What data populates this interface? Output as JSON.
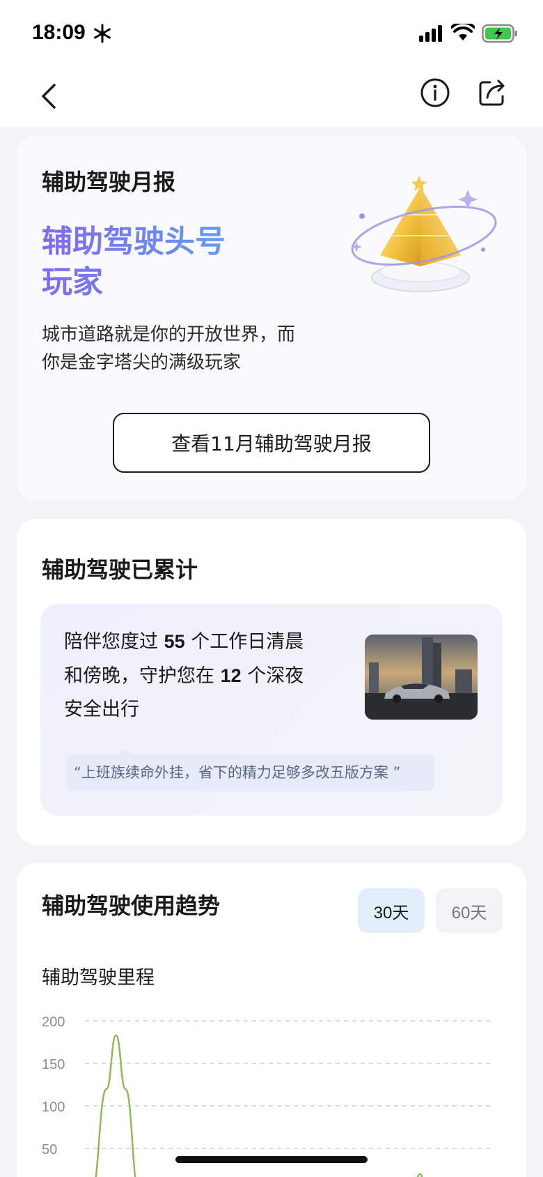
{
  "status_bar": {
    "time": "18:09"
  },
  "nav": {
    "back_icon": "chevron-left-icon",
    "info_icon": "info-icon",
    "share_icon": "share-icon"
  },
  "report_card": {
    "title": "辅助驾驶月报",
    "headline_line1": "辅助驾驶头号",
    "headline_line2": "玩家",
    "description_line1": "城市道路就是你的开放世界，而",
    "description_line2": "你是金字塔尖的满级玩家",
    "button_label": "查看11月辅助驾驶月报"
  },
  "total_card": {
    "title": "辅助驾驶已累计",
    "line1_prefix": "陪伴您度过 ",
    "workdays": "55",
    "line1_suffix": " 个工作日清晨",
    "line2_prefix": "和傍晚，守护您在 ",
    "nights": "12",
    "line2_suffix": " 个深夜",
    "line3": "安全出行",
    "quote": "“上班族续命外挂，省下的精力足够多改五版方案 ”"
  },
  "trend_card": {
    "title": "辅助驾驶使用趋势",
    "tabs": [
      {
        "label": "30天",
        "selected": true
      },
      {
        "label": "60天",
        "selected": false
      }
    ],
    "chart_subtitle": "辅助驾驶里程"
  },
  "chart_data": {
    "type": "line",
    "title": "",
    "ylabel": "",
    "xlabel": "",
    "ylim": [
      0,
      200
    ],
    "y_ticks": [
      "200",
      "150",
      "100",
      "50"
    ],
    "grid": true,
    "series": [
      {
        "color": "#8fba5a",
        "points": [
          {
            "x": 0,
            "y": 0
          },
          {
            "x": 0.5,
            "y": 0
          },
          {
            "x": 1.6,
            "y": 120
          },
          {
            "x": 2.3,
            "y": 183
          },
          {
            "x": 3.0,
            "y": 120
          },
          {
            "x": 4.0,
            "y": 0
          },
          {
            "x": 24.3,
            "y": 0
          },
          {
            "x": 24.8,
            "y": 20
          },
          {
            "x": 25.3,
            "y": 0
          },
          {
            "x": 30,
            "y": 0
          }
        ]
      }
    ],
    "x_range": [
      0,
      30
    ]
  },
  "colors": {
    "accent_gradient_start": "#7f6bf0",
    "accent_gradient_end": "#5da4f2",
    "line_color": "#8fba5a",
    "tab_selected_bg": "#e3eefc"
  }
}
